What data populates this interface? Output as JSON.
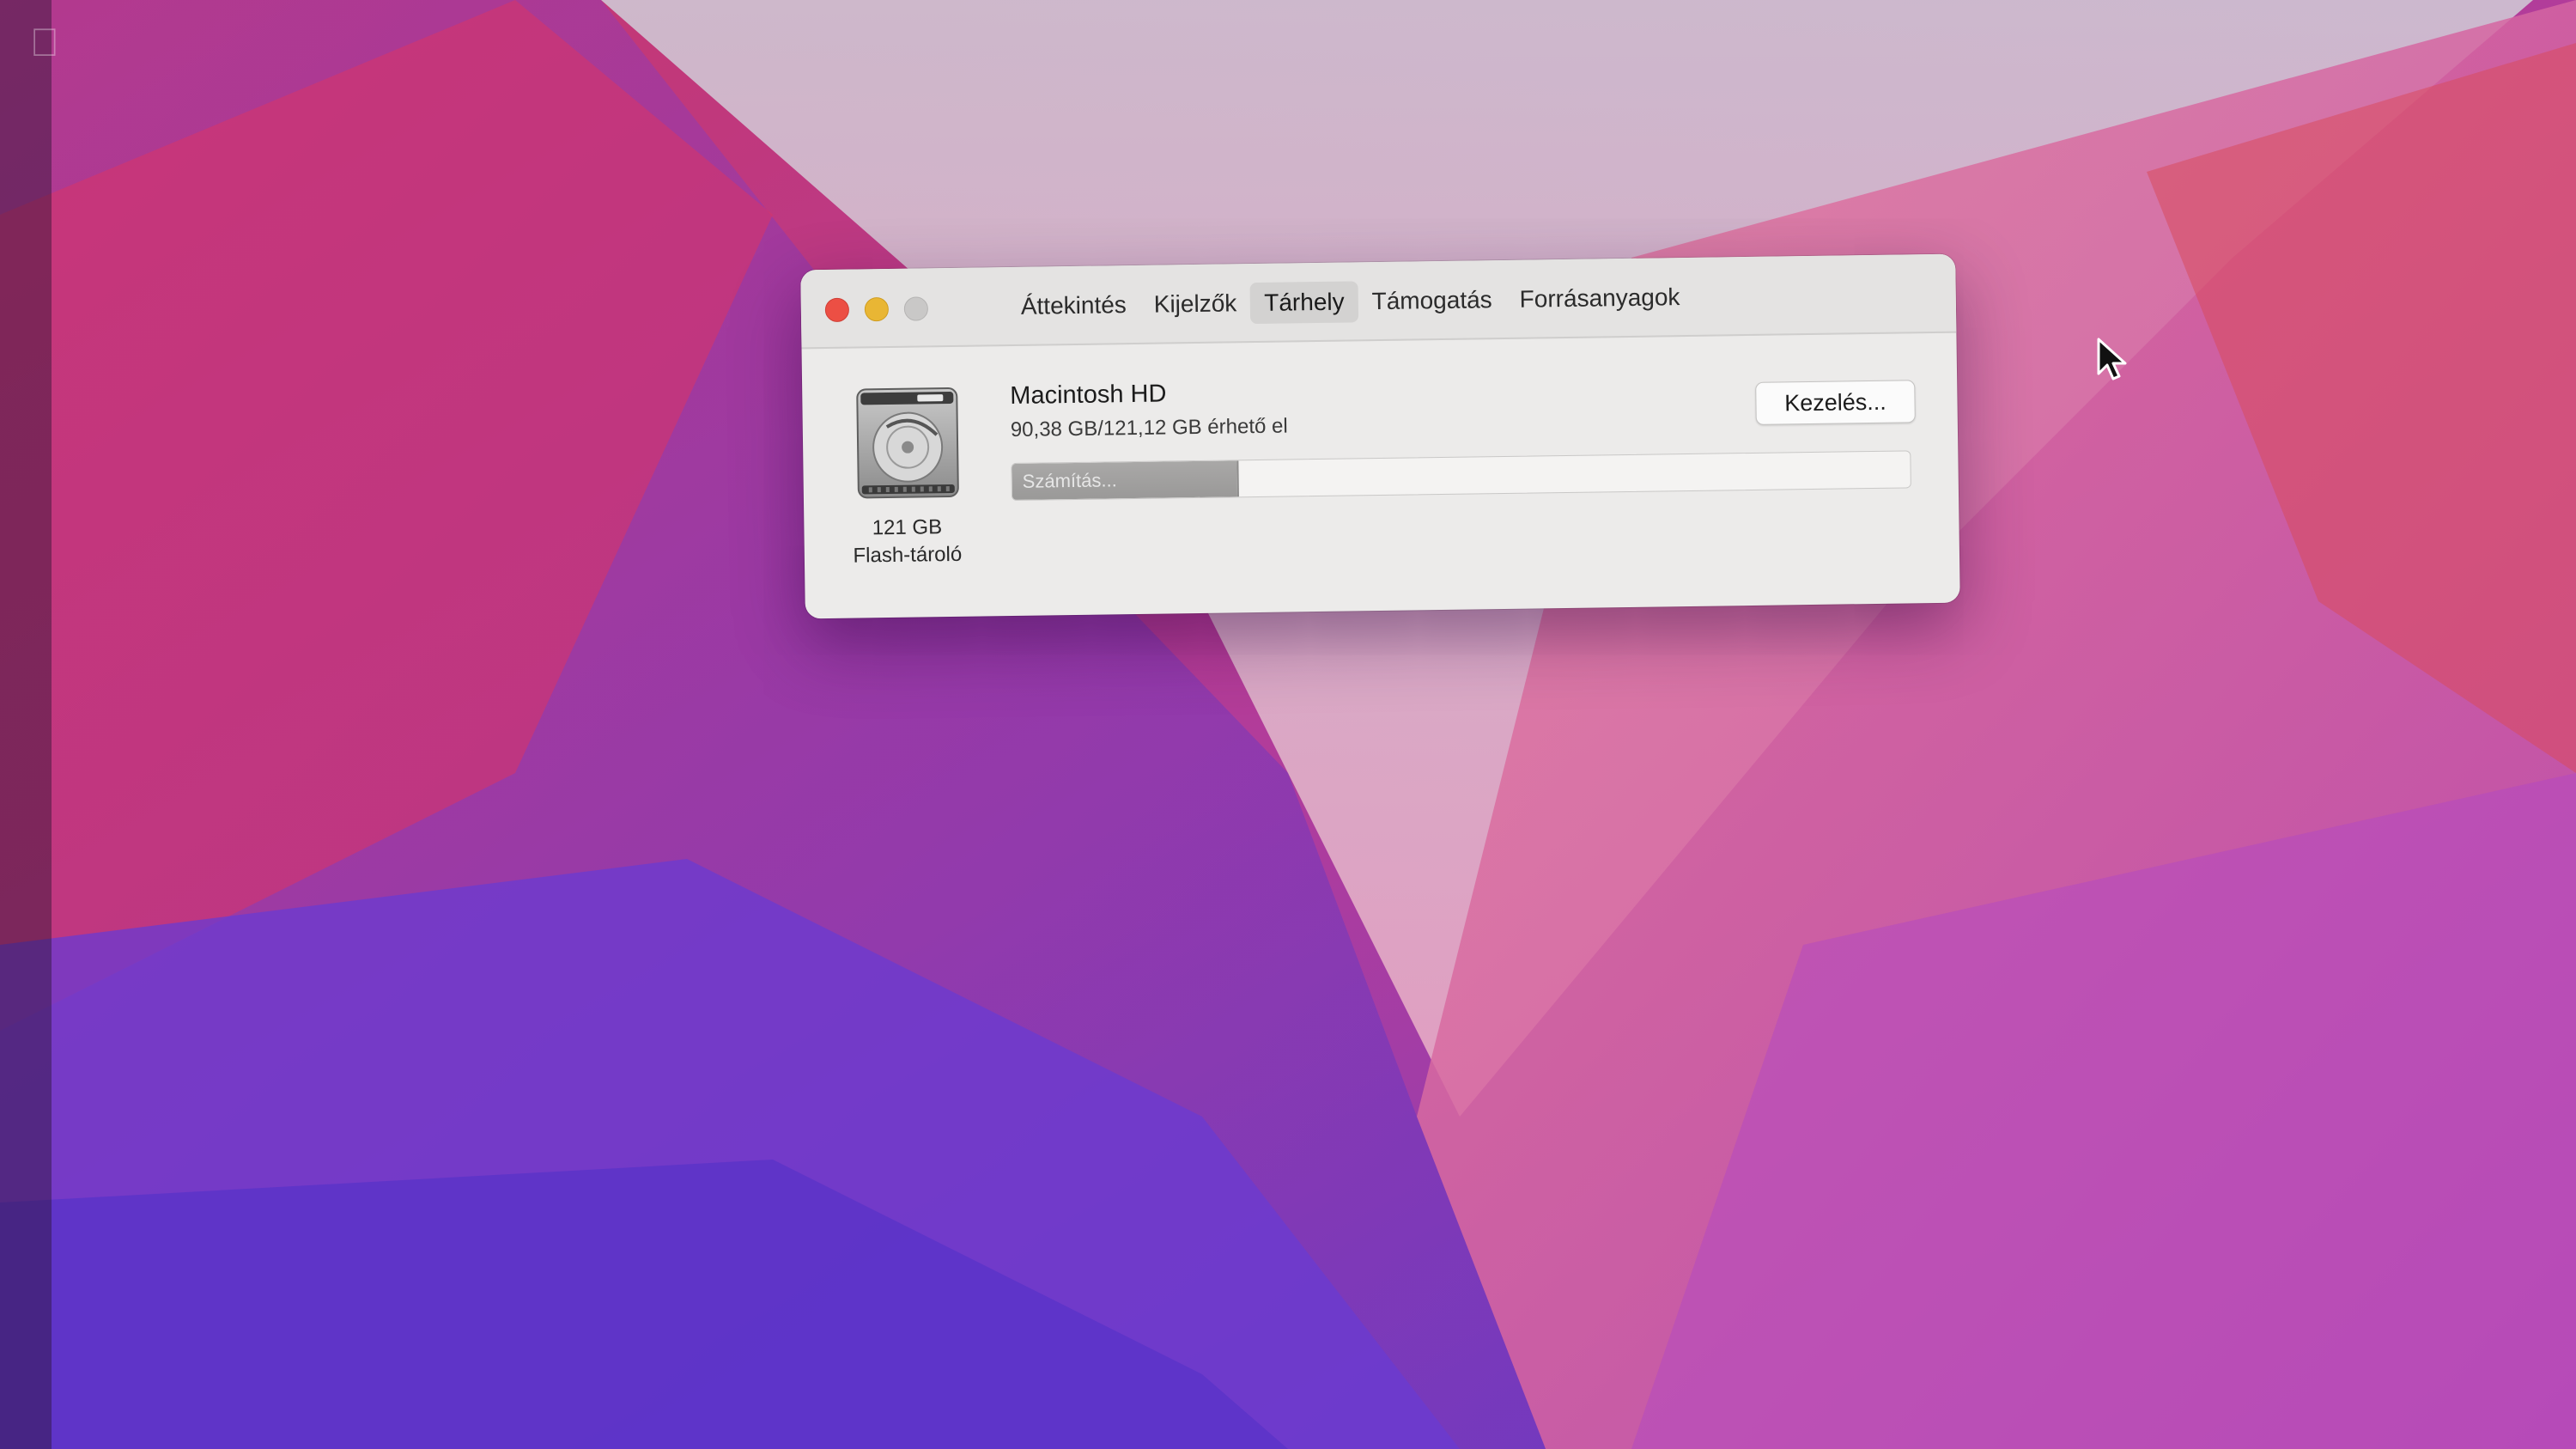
{
  "window": {
    "tabs": [
      {
        "label": "Áttekintés",
        "active": false
      },
      {
        "label": "Kijelzők",
        "active": false
      },
      {
        "label": "Tárhely",
        "active": true
      },
      {
        "label": "Támogatás",
        "active": false
      },
      {
        "label": "Forrásanyagok",
        "active": false
      }
    ]
  },
  "storage": {
    "volume_name": "Macintosh HD",
    "availability": "90,38 GB/121,12 GB érhető el",
    "capacity": "121 GB",
    "type": "Flash-tároló",
    "manage_label": "Kezelés...",
    "bar_label": "Számítás...",
    "bar_fraction": 0.25
  },
  "icons": {
    "disk": "internal-disk-icon",
    "apple": "apple-logo-icon",
    "cursor": "mouse-pointer-icon"
  },
  "colors": {
    "close": "#ec4f44",
    "minimize": "#e9b634",
    "zoom_disabled": "#c9c8c7"
  }
}
